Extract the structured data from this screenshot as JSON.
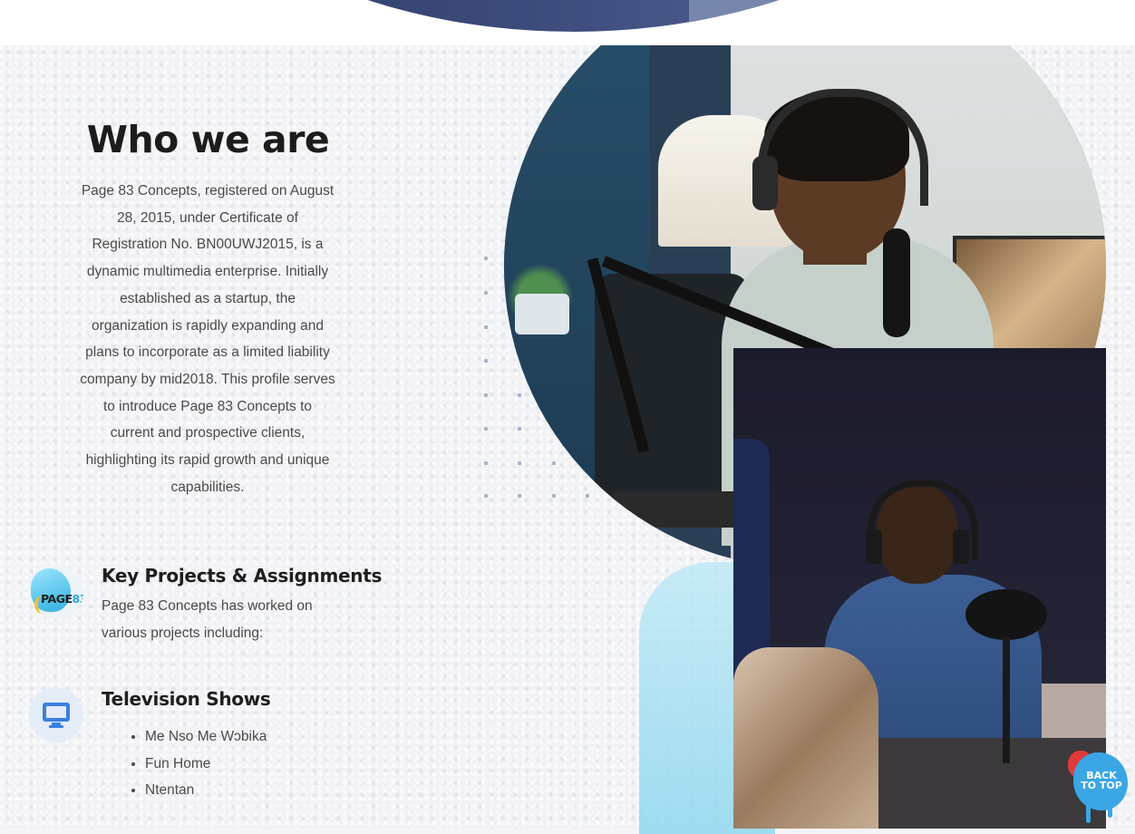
{
  "about": {
    "title": "Who we are",
    "body": "Page 83 Concepts, registered on August 28, 2015, under Certificate of Registration No. BN00UWJ2015, is a dynamic multimedia enterprise. Initially established as a startup, the organization is rapidly expanding and plans to incorporate as a limited liability company by mid2018. This profile serves to introduce Page 83 Concepts to current and prospective clients, highlighting its rapid growth and unique capabilities."
  },
  "projects": {
    "logo_text": "PAGE",
    "logo_num": "83",
    "title": "Key Projects & Assignments",
    "description": "Page 83 Concepts has worked on various projects including:"
  },
  "tv": {
    "icon": "monitor-icon",
    "title": "Television Shows",
    "shows": [
      "Me Nso Me Wɔbika",
      "Fun Home",
      "Ntentan"
    ]
  },
  "back_to_top": {
    "line1": "BACK",
    "line2": "TO TOP"
  },
  "colors": {
    "heading": "#1c1c1c",
    "body_text": "#4a4a4a",
    "accent_blue": "#3aa6e4",
    "navy_banner": "#2d3a66"
  }
}
